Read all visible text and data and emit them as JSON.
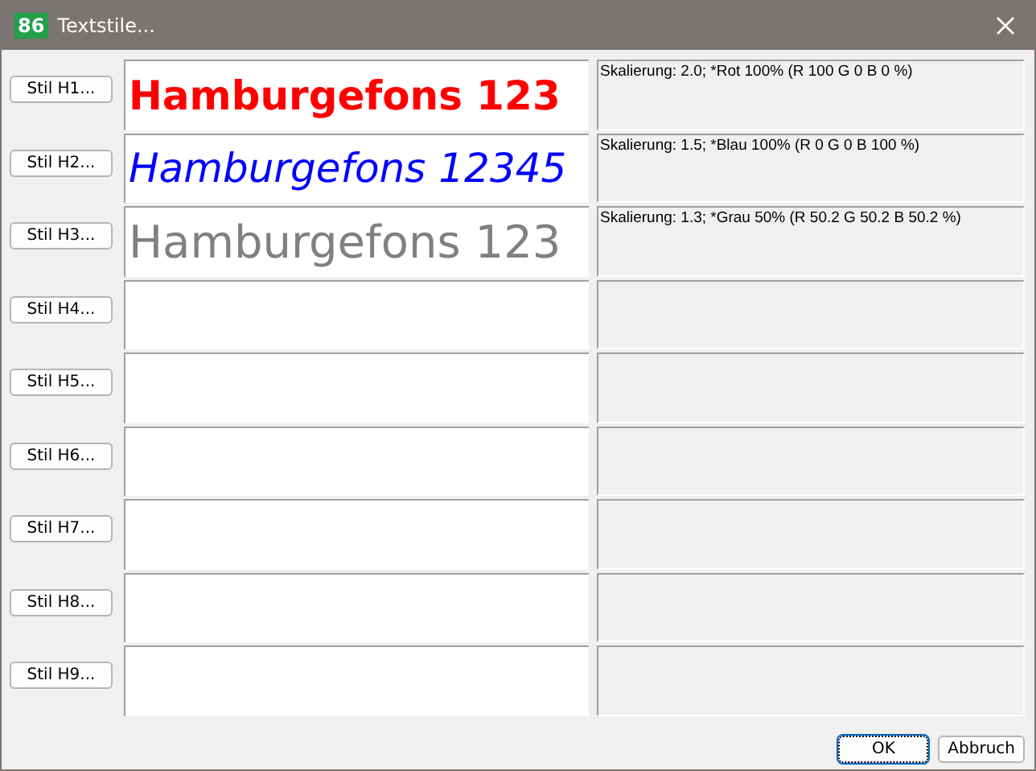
{
  "window": {
    "title": "Textstile...",
    "app_icon": "86"
  },
  "styles": [
    {
      "button": "Stil H1...",
      "preview": "Hamburgefons 123",
      "color": "#ff0000",
      "kind": "bold",
      "description": "Skalierung: 2.0; *Rot 100% (R 100 G 0 B 0 %)"
    },
    {
      "button": "Stil H2...",
      "preview": "Hamburgefons 12345",
      "color": "#0000ff",
      "kind": "italic",
      "description": "Skalierung: 1.5; *Blau 100% (R 0 G 0 B 100 %)"
    },
    {
      "button": "Stil H3...",
      "preview": "Hamburgefons 123",
      "color": "#808080",
      "kind": "regular",
      "description": "Skalierung: 1.3; *Grau 50% (R 50.2 G 50.2 B 50.2 %)"
    },
    {
      "button": "Stil H4..."
    },
    {
      "button": "Stil H5..."
    },
    {
      "button": "Stil H6..."
    },
    {
      "button": "Stil H7..."
    },
    {
      "button": "Stil H8..."
    },
    {
      "button": "Stil H9..."
    }
  ],
  "buttons": {
    "ok": "OK",
    "cancel": "Abbruch"
  }
}
